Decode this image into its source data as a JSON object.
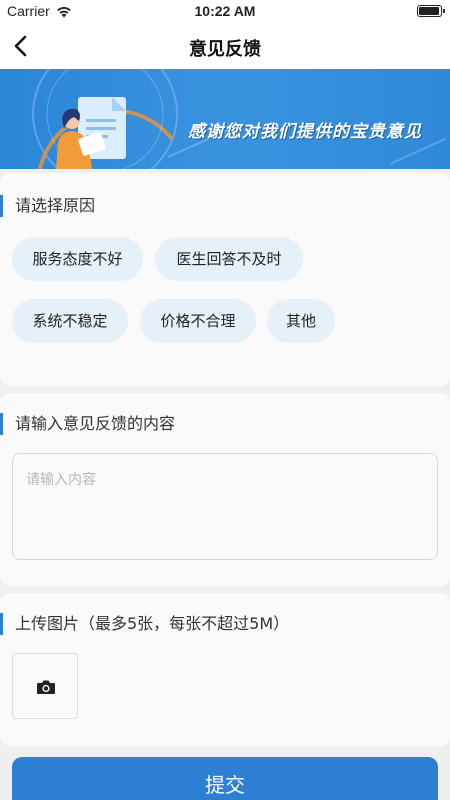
{
  "status_bar": {
    "carrier": "Carrier",
    "time": "10:22 AM"
  },
  "nav": {
    "title": "意见反馈",
    "back_icon": "chevron-left-icon"
  },
  "banner": {
    "text": "感谢您对我们提供的宝贵意见",
    "illustration": "person-with-document-illustration"
  },
  "reason_section": {
    "title": "请选择原因",
    "options": [
      "服务态度不好",
      "医生回答不及时",
      "系统不稳定",
      "价格不合理",
      "其他"
    ]
  },
  "content_section": {
    "title": "请输入意见反馈的内容",
    "placeholder": "请输入内容",
    "value": ""
  },
  "upload_section": {
    "title": "上传图片（最多5张，每张不超过5M）",
    "add_icon": "camera-icon"
  },
  "submit": {
    "label": "提交"
  },
  "colors": {
    "accent": "#2d7fd4",
    "chip_bg": "#e6f0f9",
    "banner_bg": "#3a93df"
  }
}
